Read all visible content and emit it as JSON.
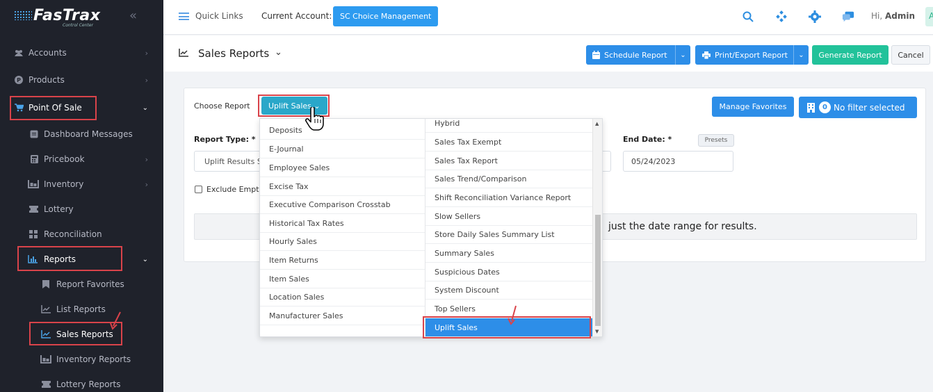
{
  "app": {
    "logo": "FasTrax",
    "logo_sub": "Control Center"
  },
  "sidebar": {
    "items": [
      {
        "label": "Accounts",
        "icon": "users-icon"
      },
      {
        "label": "Products",
        "icon": "p-circle-icon"
      },
      {
        "label": "Point Of Sale",
        "icon": "cart-icon"
      },
      {
        "label": "Dashboard Messages",
        "icon": "message-icon"
      },
      {
        "label": "Pricebook",
        "icon": "calculator-icon"
      },
      {
        "label": "Inventory",
        "icon": "inventory-icon"
      },
      {
        "label": "Lottery",
        "icon": "ticket-icon"
      },
      {
        "label": "Reconciliation",
        "icon": "grid-icon"
      },
      {
        "label": "Reports",
        "icon": "bar-chart-icon"
      },
      {
        "label": "Report Favorites",
        "icon": "bookmark-icon"
      },
      {
        "label": "List Reports",
        "icon": "line-chart-icon"
      },
      {
        "label": "Sales Reports",
        "icon": "line-chart-icon"
      },
      {
        "label": "Inventory Reports",
        "icon": "inventory-icon"
      },
      {
        "label": "Lottery Reports",
        "icon": "ticket-icon"
      }
    ]
  },
  "topbar": {
    "quick_links": "Quick Links",
    "current_account_label": "Current Account:",
    "current_account": "SC Choice Management",
    "greeting_prefix": "Hi, ",
    "user": "Admin",
    "avatar_initial": "A"
  },
  "page": {
    "title": "Sales Reports",
    "schedule": "Schedule Report",
    "print": "Print/Export Report",
    "generate": "Generate Report",
    "cancel": "Cancel"
  },
  "card": {
    "choose_label": "Choose Report",
    "selected_report": "Uplift Sales",
    "manage_favorites": "Manage Favorites",
    "filter_count": "0",
    "filter_label": "No filter selected",
    "report_type_label": "Report Type: *",
    "report_type_value": "Uplift Results S",
    "end_date_label": "End Date: *",
    "presets": "Presets",
    "end_date": "05/24/2023",
    "exclude_label": "Exclude Empt",
    "message": "just the date range for results."
  },
  "dropdown": {
    "left": [
      "Deposits",
      "E-Journal",
      "Employee Sales",
      "Excise Tax",
      "Executive Comparison Crosstab",
      "Historical Tax Rates",
      "Hourly Sales",
      "Item Returns",
      "Item Sales",
      "Location Sales",
      "Manufacturer Sales"
    ],
    "right": [
      "Hybrid",
      "Sales Tax Exempt",
      "Sales Tax Report",
      "Sales Trend/Comparison",
      "Shift Reconciliation Variance Report",
      "Slow Sellers",
      "Store Daily Sales Summary List",
      "Summary Sales",
      "Suspicious Dates",
      "System Discount",
      "Top Sellers",
      "Uplift Sales"
    ]
  },
  "colors": {
    "sidebar_bg": "#1f222b",
    "primary": "#2d8ee8",
    "teal": "#2aa7c9",
    "green": "#22c29a",
    "highlight": "#d9434a"
  }
}
